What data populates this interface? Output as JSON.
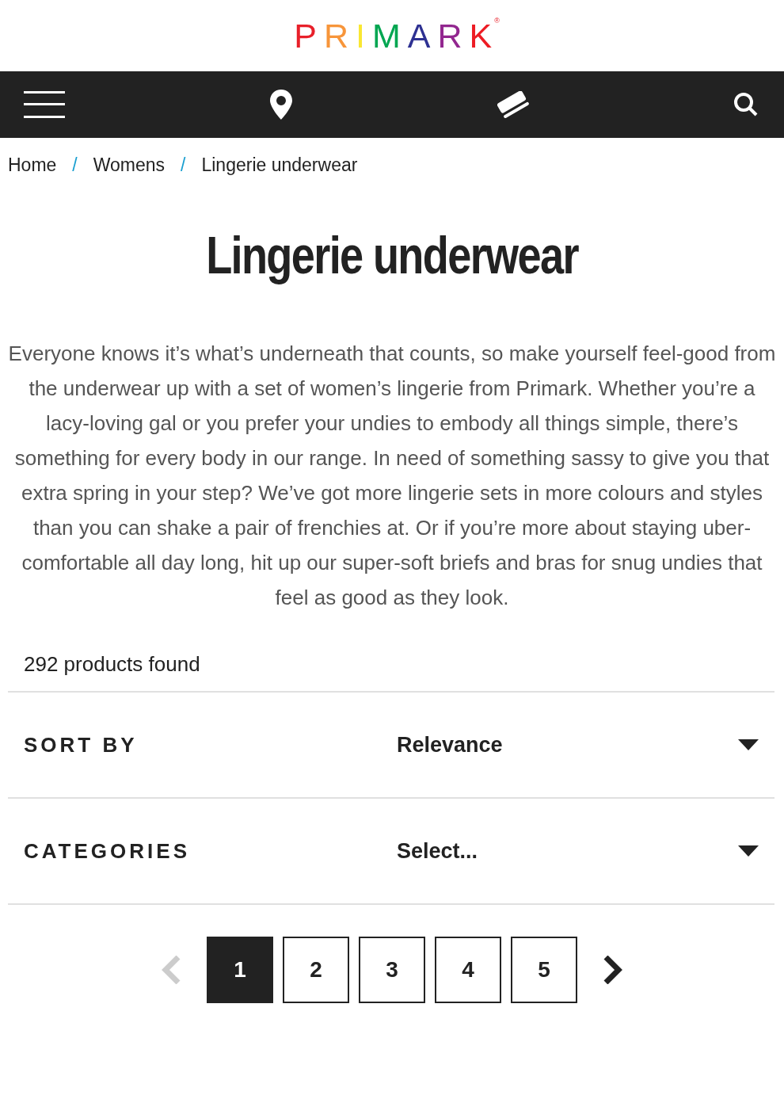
{
  "logo": {
    "letters": [
      {
        "char": "P",
        "color": "#e8202a"
      },
      {
        "char": "R",
        "color": "#f7953a"
      },
      {
        "char": "I",
        "color": "#f9e733"
      },
      {
        "char": "M",
        "color": "#00a651"
      },
      {
        "char": "A",
        "color": "#2e3192"
      },
      {
        "char": "R",
        "color": "#92278f"
      },
      {
        "char": "K",
        "color": "#ed1c24"
      }
    ],
    "mark": "®"
  },
  "breadcrumb": [
    "Home",
    "Womens",
    "Lingerie underwear"
  ],
  "breadcrumb_separator": "/",
  "title": "Lingerie underwear",
  "description": "Everyone knows it’s what’s underneath that counts, so make yourself feel-good from the underwear up with a set of women’s lingerie from Primark. Whether you’re a lacy-loving gal or you prefer your undies to embody all things simple, there’s something for every body in our range. In need of something sassy to give you that extra spring in your step? We’ve got more lingerie sets in more colours and styles than you can shake a pair of frenchies at. Or if you’re more about staying uber-comfortable all day long, hit up our super-soft briefs and bras for snug undies that feel as good as they look.",
  "results_count": "292 products found",
  "filters": [
    {
      "label": "SORT BY",
      "value": "Relevance"
    },
    {
      "label": "CATEGORIES",
      "value": "Select..."
    }
  ],
  "pagination": {
    "prev_disabled": true,
    "next_disabled": false,
    "pages": [
      {
        "label": "1",
        "selected": true
      },
      {
        "label": "2",
        "selected": false
      },
      {
        "label": "3",
        "selected": false
      },
      {
        "label": "4",
        "selected": false
      },
      {
        "label": "5",
        "selected": false
      }
    ]
  }
}
